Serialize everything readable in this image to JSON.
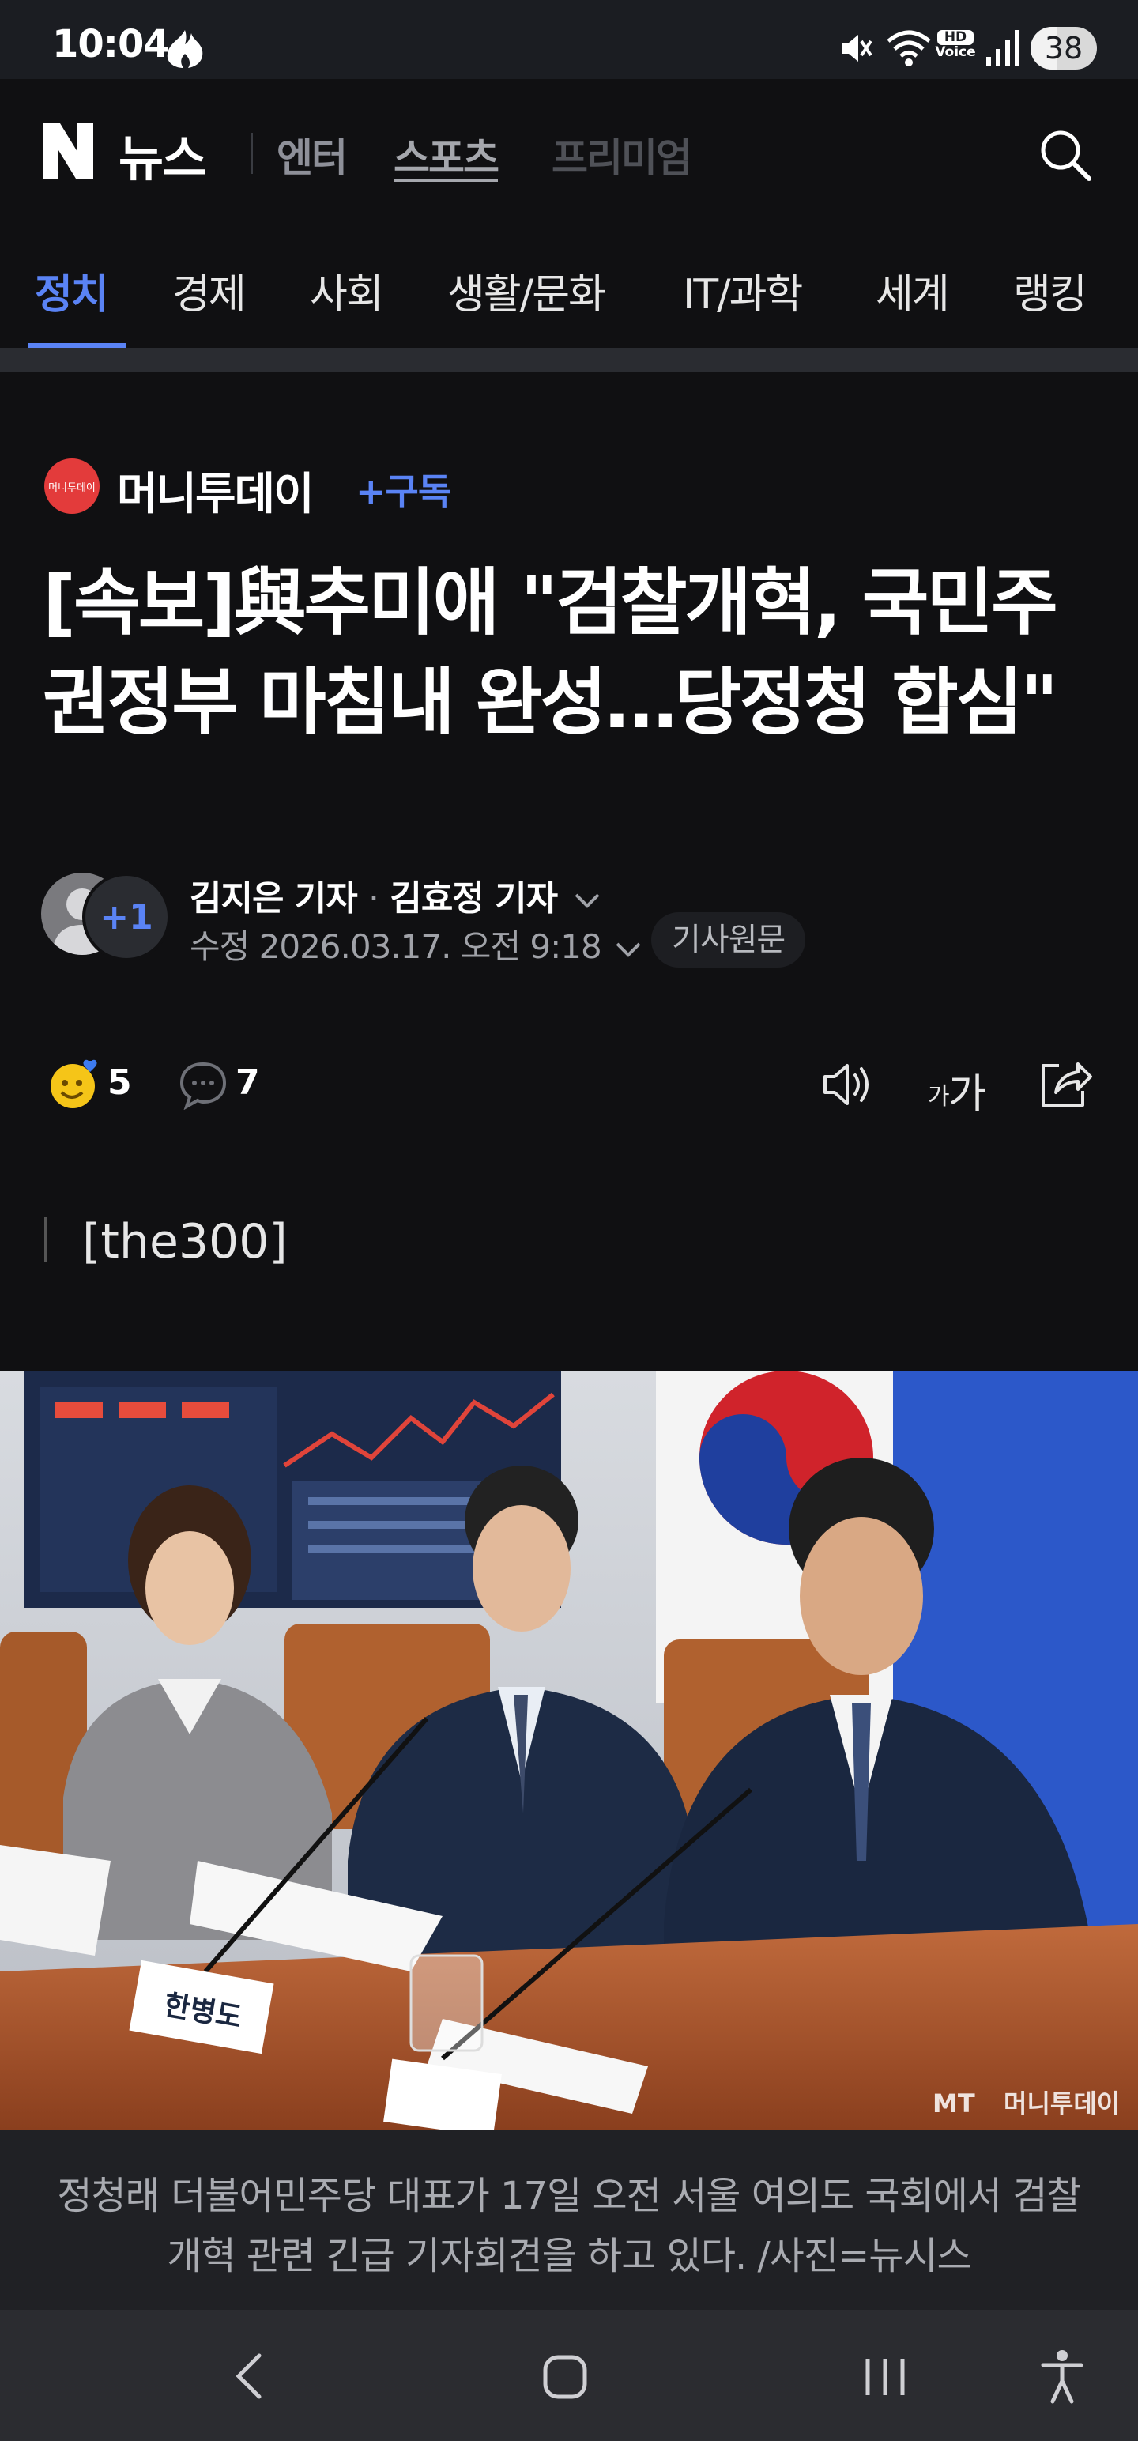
{
  "status_bar": {
    "time": "10:04",
    "battery": "38",
    "hd_label_top": "HD",
    "hd_label_bottom": "Voice",
    "icons": [
      "flame-icon",
      "mute-icon",
      "wifi-icon",
      "hd-voice-icon",
      "signal-icon",
      "battery-icon"
    ]
  },
  "header": {
    "logo_letter": "N",
    "logo_text": "뉴스",
    "top_nav": [
      "엔터",
      "스포츠",
      "프리미엄"
    ],
    "search_icon": "search-icon"
  },
  "categories": [
    "정치",
    "경제",
    "사회",
    "생활/문화",
    "IT/과학",
    "세계",
    "랭킹"
  ],
  "active_category": "정치",
  "article": {
    "press_logo_text": "머니투데이",
    "press_name": "머니투데이",
    "subscribe_label": "+구독",
    "headline": "[속보]與추미애 \"검찰개혁, 국민주권정부 마침내 완성…당정청 합심\"",
    "avatar_more": "+1",
    "reporter_1": "김지은 기자",
    "reporter_sep": "·",
    "reporter_2": "김효정 기자",
    "modified": "수정 2026.03.17. 오전 9:18",
    "original_label": "기사원문",
    "reaction_count": "5",
    "comment_count": "7",
    "font_size_small": "가",
    "font_size_large": "가",
    "quote": "[the300]",
    "photo_watermark": "MT",
    "photo_watermark_brand": "머니투데이",
    "nameplate_1": "한병도",
    "caption": "정청래 더불어민주당 대표가 17일 오전 서울 여의도 국회에서 검찰개혁 관련 긴급 기자회견을 하고 있다. /사진=뉴시스"
  },
  "colors": {
    "accent": "#5a83f5",
    "background": "#101012",
    "press_logo": "#e33b3b"
  }
}
